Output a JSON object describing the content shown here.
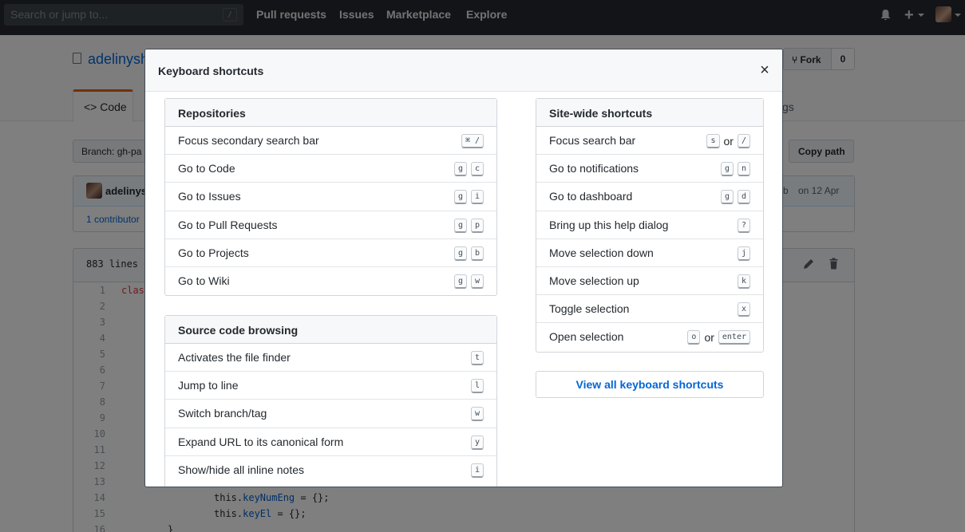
{
  "topnav": {
    "search_placeholder": "Search or jump to...",
    "search_key": "/",
    "links": [
      "Pull requests",
      "Issues",
      "Marketplace",
      "Explore"
    ]
  },
  "repo": {
    "name": "adelinysh",
    "fork_label": "Fork",
    "fork_count": "0",
    "tab_code": "Code",
    "tab_settings_tail": "gs",
    "branch_label": "Branch: gh-pa",
    "copy_path": "Copy path",
    "commit_author": "adelinys",
    "commit_hash_tail": "b",
    "commit_date": "on 12 Apr",
    "contributors": "1 contributor",
    "file_lines": "883 lines"
  },
  "code": {
    "line_numbers": [
      "1",
      "2",
      "3",
      "4",
      "5",
      "6",
      "7",
      "8",
      "9",
      "10",
      "11",
      "12",
      "13",
      "14",
      "15",
      "16"
    ],
    "line1": "clas",
    "line14_this": "this.",
    "line14_prop": "keyNumEng",
    "line14_rest": " = {};",
    "line15_this": "this.",
    "line15_prop": "keyEl",
    "line15_rest": " = {};",
    "line16": "}"
  },
  "modal": {
    "title": "Keyboard shortcuts",
    "close": "×",
    "view_all": "View all keyboard shortcuts",
    "or_text": "or",
    "repositories": {
      "title": "Repositories",
      "rows": [
        {
          "label": "Focus secondary search bar",
          "keys": [
            "⌘ /"
          ]
        },
        {
          "label": "Go to Code",
          "keys": [
            "g",
            "c"
          ]
        },
        {
          "label": "Go to Issues",
          "keys": [
            "g",
            "i"
          ]
        },
        {
          "label": "Go to Pull Requests",
          "keys": [
            "g",
            "p"
          ]
        },
        {
          "label": "Go to Projects",
          "keys": [
            "g",
            "b"
          ]
        },
        {
          "label": "Go to Wiki",
          "keys": [
            "g",
            "w"
          ]
        }
      ]
    },
    "source_code": {
      "title": "Source code browsing",
      "rows": [
        {
          "label": "Activates the file finder",
          "keys": [
            "t"
          ]
        },
        {
          "label": "Jump to line",
          "keys": [
            "l"
          ]
        },
        {
          "label": "Switch branch/tag",
          "keys": [
            "w"
          ]
        },
        {
          "label": "Expand URL to its canonical form",
          "keys": [
            "y"
          ]
        },
        {
          "label": "Show/hide all inline notes",
          "keys": [
            "i"
          ]
        }
      ]
    },
    "site_wide": {
      "title": "Site-wide shortcuts",
      "rows": [
        {
          "label": "Focus search bar",
          "keys": [
            "s",
            "/"
          ],
          "or": true
        },
        {
          "label": "Go to notifications",
          "keys": [
            "g",
            "n"
          ]
        },
        {
          "label": "Go to dashboard",
          "keys": [
            "g",
            "d"
          ]
        },
        {
          "label": "Bring up this help dialog",
          "keys": [
            "?"
          ]
        },
        {
          "label": "Move selection down",
          "keys": [
            "j"
          ]
        },
        {
          "label": "Move selection up",
          "keys": [
            "k"
          ]
        },
        {
          "label": "Toggle selection",
          "keys": [
            "x"
          ]
        },
        {
          "label": "Open selection",
          "keys": [
            "o",
            "enter"
          ],
          "or": true
        }
      ]
    }
  },
  "colors": {
    "nav_bg": "#24292e",
    "link_blue": "#0366d6",
    "overlay": "rgba(0,0,0,0.5)",
    "tab_accent": "#e36209"
  }
}
